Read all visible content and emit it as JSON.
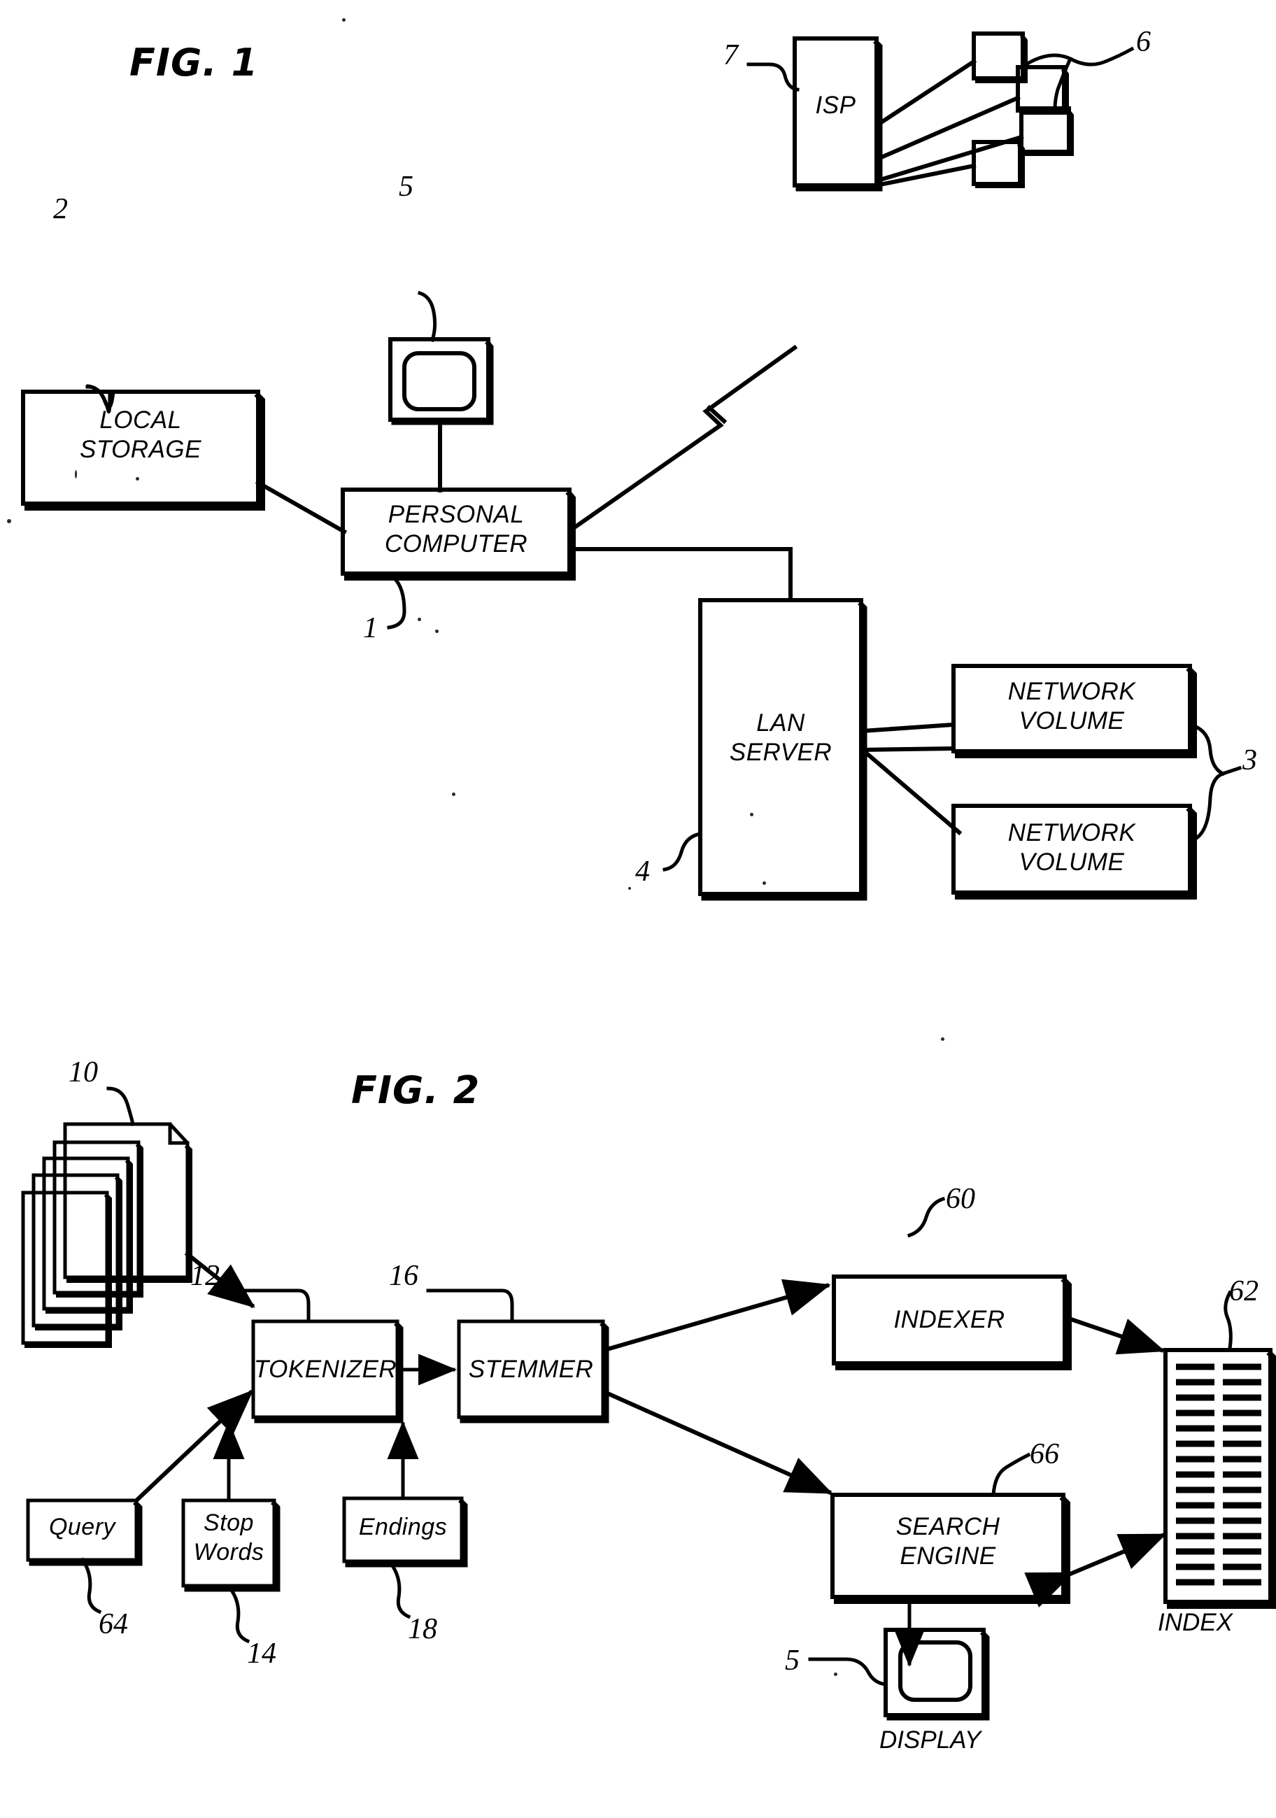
{
  "figures": [
    {
      "id": "fig1",
      "title": "FIG. 1",
      "nodes": {
        "local_storage": "LOCAL\nSTORAGE",
        "personal_computer": "PERSONAL\nCOMPUTER",
        "monitor": "",
        "isp": "ISP",
        "lan_server": "LAN\nSERVER",
        "network_volume_1": "NETWORK\nVOLUME",
        "network_volume_2": "NETWORK\nVOLUME"
      },
      "reference_numerals": {
        "local_storage": "2",
        "monitor": "5",
        "personal_computer": "1",
        "isp": "7",
        "remote_clients": "6",
        "network_volumes": "3",
        "lan_server": "4"
      }
    },
    {
      "id": "fig2",
      "title": "FIG. 2",
      "nodes": {
        "documents": "",
        "tokenizer": "TOKENIZER",
        "stemmer": "STEMMER",
        "indexer": "INDEXER",
        "search_engine": "SEARCH\nENGINE",
        "index": "",
        "query": "Query",
        "stop_words": "Stop\nWords",
        "endings": "Endings",
        "display": ""
      },
      "captions": {
        "index": "INDEX",
        "display": "DISPLAY"
      },
      "reference_numerals": {
        "documents": "10",
        "tokenizer": "12",
        "stop_words": "14",
        "stemmer": "16",
        "endings": "18",
        "indexer": "60",
        "index": "62",
        "query": "64",
        "search_engine": "66",
        "display": "5"
      }
    }
  ],
  "colors": {
    "ink": "#000000",
    "paper": "#ffffff"
  }
}
